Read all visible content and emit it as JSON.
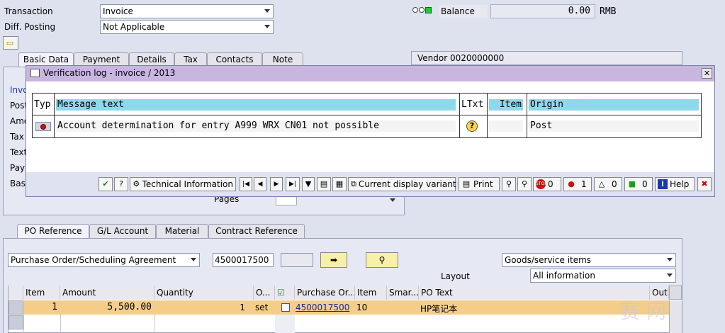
{
  "header": {
    "transaction_label": "Transaction",
    "transaction_value": "Invoice",
    "diff_posting_label": "Diff. Posting",
    "diff_posting_value": "Not Applicable",
    "balance_label": "Balance",
    "balance_value": "0.00",
    "currency": "RMB"
  },
  "top_tabs": [
    "Basic Data",
    "Payment",
    "Details",
    "Tax",
    "Contacts",
    "Note"
  ],
  "vendor_label": "Vendor 0020000000",
  "left_fields": [
    "Invo",
    "Post",
    "Amo",
    "Tax",
    "Text",
    "Payn",
    "Base"
  ],
  "pages_label": "Pages",
  "dialog": {
    "title": "Verification log - invoice  / 2013",
    "columns": [
      "Typ",
      "Message text",
      "LTxt",
      "Item",
      "Origin"
    ],
    "rows": [
      {
        "message": "Account determination for entry A999 WRX CN01 not possible",
        "item": "",
        "origin": "Post"
      }
    ],
    "toolbar": {
      "technical_info": "Technical Information",
      "current_variant": "Current display variant",
      "print": "Print",
      "stop_count": "0",
      "error_count": "1",
      "warning_count": "0",
      "success_count": "0",
      "help": "Help"
    }
  },
  "bottom_tabs": [
    "PO Reference",
    "G/L Account",
    "Material",
    "Contract Reference"
  ],
  "po_ref": {
    "type_value": "Purchase Order/Scheduling Agreement",
    "po_number": "4500017500",
    "items_value": "Goods/service items",
    "layout_label": "Layout",
    "layout_value": "All information"
  },
  "items_table": {
    "columns": [
      "Item",
      "Amount",
      "Quantity",
      "O...",
      "",
      "Purchase Or...",
      "Item",
      "Smar...",
      "PO Text",
      "Outl"
    ],
    "rows": [
      {
        "item": "1",
        "amount": "5,500.00",
        "quantity": "1",
        "unit": "set",
        "po": "4500017500",
        "po_item": "10",
        "po_text": "HP笔记本"
      }
    ]
  },
  "watermark": "赛 网"
}
